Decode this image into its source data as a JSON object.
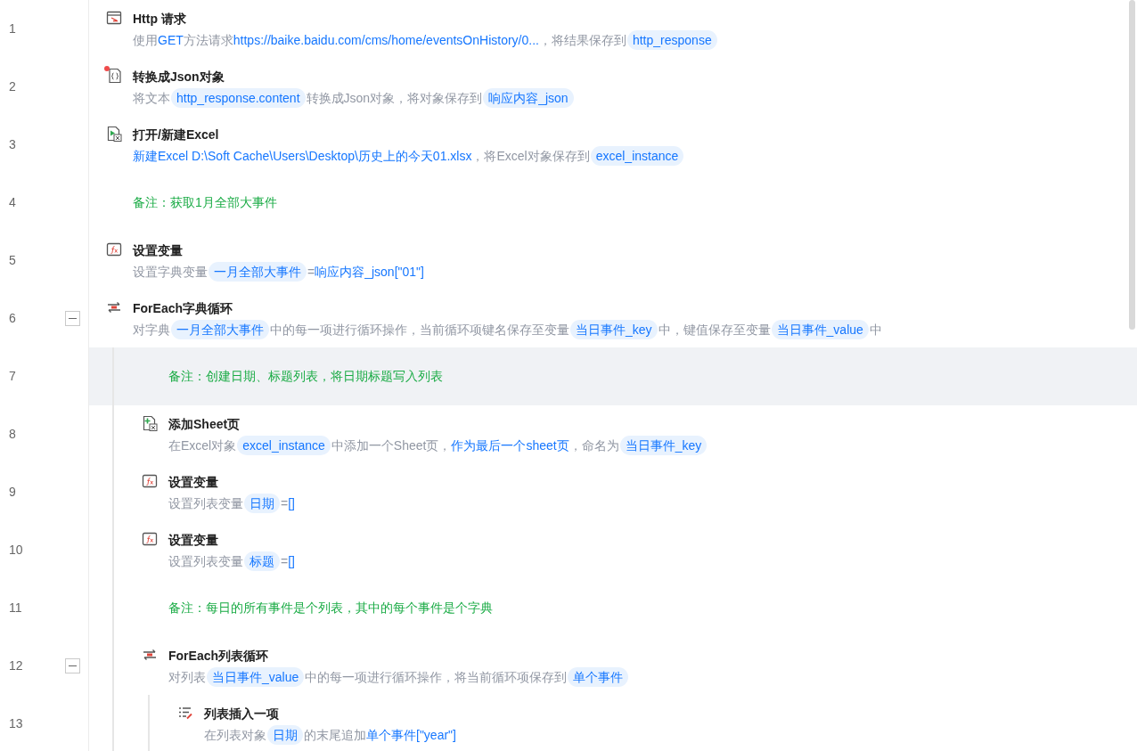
{
  "steps": [
    {
      "line": "1",
      "kind": "http",
      "title": "Http 请求",
      "flagged": false,
      "selected": false,
      "desc": [
        {
          "kind": "text",
          "text": "使用"
        },
        {
          "kind": "value",
          "text": "GET"
        },
        {
          "kind": "text",
          "text": "方法请求"
        },
        {
          "kind": "value",
          "text": "https://baike.baidu.com/cms/home/eventsOnHistory/0..."
        },
        {
          "kind": "text",
          "text": "，将结果保存到"
        },
        {
          "kind": "var",
          "text": "http_response"
        }
      ]
    },
    {
      "line": "2",
      "kind": "json",
      "title": "转换成Json对象",
      "flagged": true,
      "selected": false,
      "desc": [
        {
          "kind": "text",
          "text": "将文本"
        },
        {
          "kind": "var",
          "text": "http_response.content"
        },
        {
          "kind": "text",
          "text": "转换成Json对象，将对象保存到"
        },
        {
          "kind": "var",
          "text": "响应内容_json"
        }
      ]
    },
    {
      "line": "3",
      "kind": "excel-open",
      "title": "打开/新建Excel",
      "flagged": false,
      "selected": false,
      "desc": [
        {
          "kind": "value",
          "text": "新建Excel D:\\Soft Cache\\Users\\Desktop\\历史上的今天01.xlsx"
        },
        {
          "kind": "text",
          "text": "，将Excel对象保存到"
        },
        {
          "kind": "var",
          "text": "excel_instance"
        }
      ]
    },
    {
      "line": "4",
      "kind": "comment",
      "text": "备注：获取1月全部大事件",
      "selected": false
    },
    {
      "line": "5",
      "kind": "set-var",
      "title": "设置变量",
      "flagged": false,
      "selected": false,
      "desc": [
        {
          "kind": "text",
          "text": "设置字典变量"
        },
        {
          "kind": "var",
          "text": "一月全部大事件"
        },
        {
          "kind": "text",
          "text": "="
        },
        {
          "kind": "value",
          "text": "响应内容_json[\"01\"]"
        }
      ]
    },
    {
      "line": "6",
      "kind": "loop",
      "title": "ForEach字典循环",
      "flagged": false,
      "selected": false,
      "expanded": true,
      "desc": [
        {
          "kind": "text",
          "text": "对字典"
        },
        {
          "kind": "var",
          "text": "一月全部大事件"
        },
        {
          "kind": "text",
          "text": "中的每一项进行循环操作，当前循环项键名保存至变量"
        },
        {
          "kind": "var",
          "text": "当日事件_key"
        },
        {
          "kind": "text",
          "text": "中，键值保存至变量"
        },
        {
          "kind": "var",
          "text": "当日事件_value"
        },
        {
          "kind": "text",
          "text": "中"
        }
      ],
      "children": [
        {
          "line": "7",
          "kind": "comment",
          "text": "备注：创建日期、标题列表，将日期标题写入列表",
          "selected": true
        },
        {
          "line": "8",
          "kind": "add-sheet",
          "title": "添加Sheet页",
          "flagged": false,
          "selected": false,
          "desc": [
            {
              "kind": "text",
              "text": "在Excel对象"
            },
            {
              "kind": "var",
              "text": "excel_instance"
            },
            {
              "kind": "text",
              "text": "中添加一个Sheet页，"
            },
            {
              "kind": "value",
              "text": "作为最后一个sheet页"
            },
            {
              "kind": "text",
              "text": "，命名为"
            },
            {
              "kind": "var",
              "text": "当日事件_key"
            }
          ]
        },
        {
          "line": "9",
          "kind": "set-var",
          "title": "设置变量",
          "flagged": false,
          "selected": false,
          "desc": [
            {
              "kind": "text",
              "text": "设置列表变量"
            },
            {
              "kind": "var",
              "text": "日期"
            },
            {
              "kind": "text",
              "text": "="
            },
            {
              "kind": "value",
              "text": "[]"
            }
          ]
        },
        {
          "line": "10",
          "kind": "set-var",
          "title": "设置变量",
          "flagged": false,
          "selected": false,
          "desc": [
            {
              "kind": "text",
              "text": "设置列表变量"
            },
            {
              "kind": "var",
              "text": "标题"
            },
            {
              "kind": "text",
              "text": "="
            },
            {
              "kind": "value",
              "text": "[]"
            }
          ]
        },
        {
          "line": "11",
          "kind": "comment",
          "text": "备注：每日的所有事件是个列表，其中的每个事件是个字典",
          "selected": false
        },
        {
          "line": "12",
          "kind": "loop",
          "title": "ForEach列表循环",
          "flagged": false,
          "selected": false,
          "expanded": true,
          "desc": [
            {
              "kind": "text",
              "text": "对列表"
            },
            {
              "kind": "var",
              "text": "当日事件_value"
            },
            {
              "kind": "text",
              "text": "中的每一项进行循环操作，将当前循环项保存到"
            },
            {
              "kind": "var",
              "text": "单个事件"
            }
          ],
          "children": [
            {
              "line": "13",
              "kind": "list-insert",
              "title": "列表插入一项",
              "flagged": false,
              "selected": false,
              "desc": [
                {
                  "kind": "text",
                  "text": "在列表对象"
                },
                {
                  "kind": "var",
                  "text": "日期"
                },
                {
                  "kind": "text",
                  "text": "的末尾追加"
                },
                {
                  "kind": "value",
                  "text": "单个事件[\"year\"]"
                }
              ]
            }
          ]
        }
      ]
    }
  ]
}
